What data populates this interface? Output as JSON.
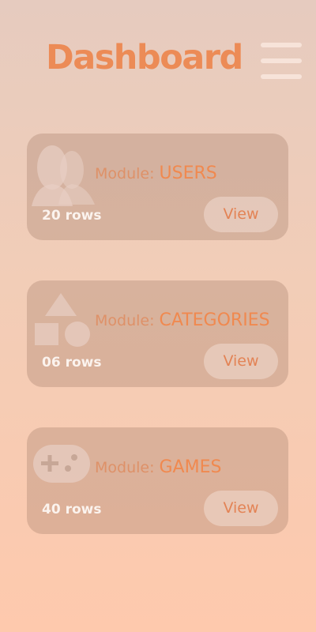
{
  "header": {
    "title": "Dashboard",
    "menu_icon": "hamburger-menu-icon"
  },
  "modules": [
    {
      "prefix": "Module:",
      "name": "USERS",
      "rows": "20 rows",
      "button": "View",
      "icon": "users-icon"
    },
    {
      "prefix": "Module:",
      "name": "CATEGORIES",
      "rows": "06 rows",
      "button": "View",
      "icon": "shapes-icon"
    },
    {
      "prefix": "Module:",
      "name": "GAMES",
      "rows": "40 rows",
      "button": "View",
      "icon": "gamepad-icon"
    }
  ],
  "colors": {
    "accent": "#ec8b56",
    "card_background": "#c7a797",
    "icon_fill": "#e8cfc4",
    "rows_text": "#fbf3ee"
  }
}
